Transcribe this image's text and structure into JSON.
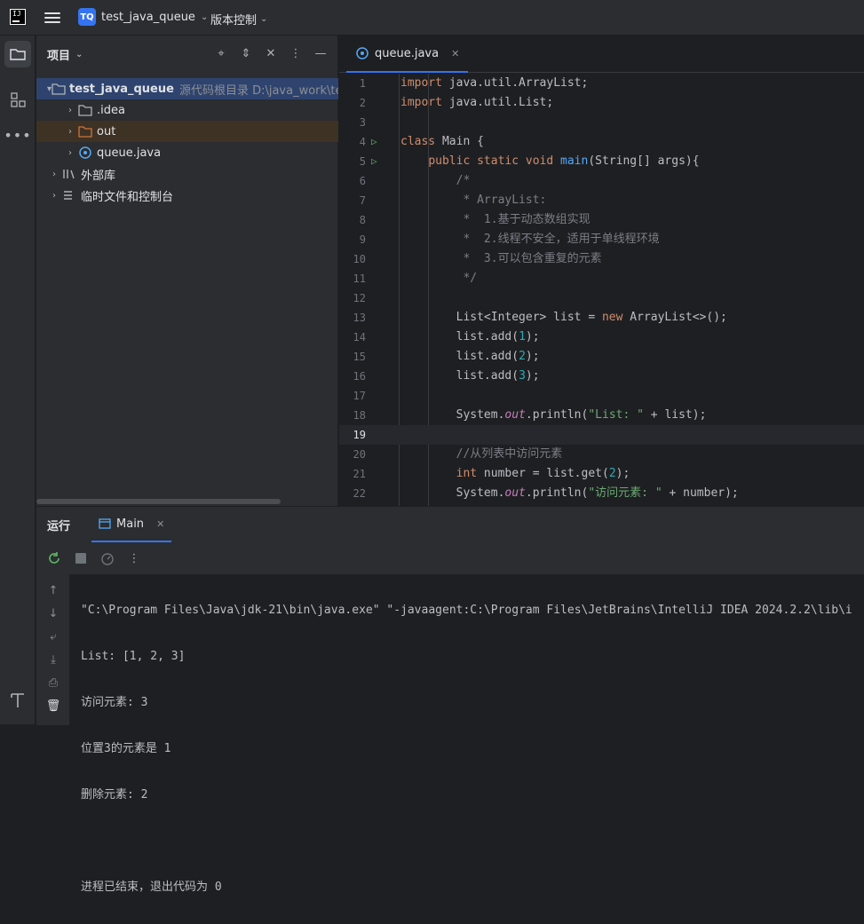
{
  "titlebar": {
    "logo": "IJ",
    "project_badge": "TQ",
    "project_name": "test_java_queue",
    "vcs_label": "版本控制"
  },
  "project_panel": {
    "title": "项目",
    "root": {
      "name": "test_java_queue",
      "detail": "源代码根目录  D:\\java_work\\test_"
    },
    "children": [
      {
        "name": ".idea"
      },
      {
        "name": "out"
      },
      {
        "name": "queue.java"
      }
    ],
    "external": "外部库",
    "scratches": "临时文件和控制台"
  },
  "editor": {
    "tab": "queue.java",
    "line_numbers": [
      "1",
      "2",
      "3",
      "4",
      "5",
      "6",
      "7",
      "8",
      "9",
      "10",
      "11",
      "12",
      "13",
      "14",
      "15",
      "16",
      "17",
      "18",
      "19",
      "20",
      "21",
      "22"
    ]
  },
  "run_panel": {
    "title": "运行",
    "tab": "Main",
    "output": [
      "\"C:\\Program Files\\Java\\jdk-21\\bin\\java.exe\" \"-javaagent:C:\\Program Files\\JetBrains\\IntelliJ IDEA 2024.2.2\\lib\\i",
      "List: [1, 2, 3]",
      "访问元素: 3",
      "位置3的元素是 1",
      "删除元素: 2",
      "",
      "进程已结束，退出代码为 0"
    ]
  },
  "colors": {
    "accent": "#3574f0",
    "keyword": "#cf8e6d",
    "string": "#6aab73",
    "number": "#2aacb8",
    "function": "#56a8f5",
    "comment": "#7a7e85",
    "run_gutter": "#5fb865"
  }
}
